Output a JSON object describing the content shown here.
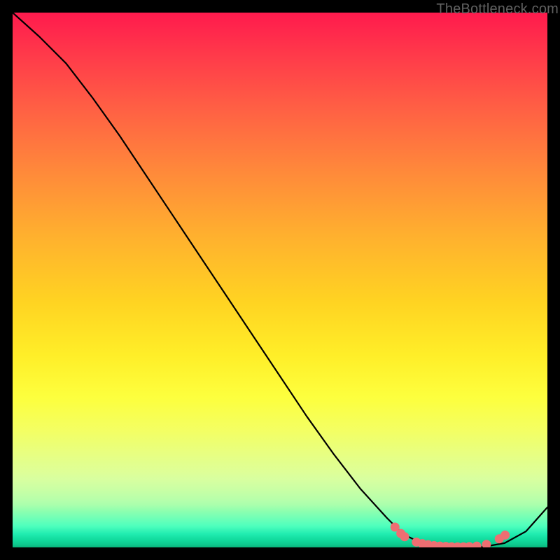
{
  "watermark": "TheBottleneck.com",
  "colors": {
    "background": "#000000",
    "curve_stroke": "#000000",
    "dot_fill": "#ee6e72"
  },
  "chart_data": {
    "type": "line",
    "title": "",
    "xlabel": "",
    "ylabel": "",
    "xlim": [
      0,
      100
    ],
    "ylim": [
      0,
      100
    ],
    "series": [
      {
        "name": "bottleneck-curve",
        "x": [
          0,
          5,
          10,
          15,
          20,
          25,
          30,
          35,
          40,
          45,
          50,
          55,
          60,
          65,
          70,
          73,
          76,
          80,
          84,
          88,
          92,
          96,
          100
        ],
        "y": [
          100,
          95.5,
          90.5,
          84.0,
          77.0,
          69.5,
          62.0,
          54.5,
          47.0,
          39.5,
          32.0,
          24.5,
          17.5,
          11.0,
          5.5,
          2.5,
          1.0,
          0.2,
          0.0,
          0.1,
          0.8,
          3.0,
          7.5
        ]
      }
    ],
    "highlight_dots": {
      "name": "flat-region-markers",
      "x": [
        71.5,
        72.6,
        73.3,
        75.5,
        76.6,
        77.7,
        78.8,
        79.9,
        81.0,
        82.1,
        83.2,
        84.3,
        85.4,
        86.8,
        88.6,
        91.0,
        92.1
      ],
      "y": [
        3.8,
        2.6,
        2.0,
        1.0,
        0.7,
        0.5,
        0.35,
        0.25,
        0.18,
        0.12,
        0.1,
        0.1,
        0.14,
        0.24,
        0.55,
        1.6,
        2.3
      ]
    }
  }
}
